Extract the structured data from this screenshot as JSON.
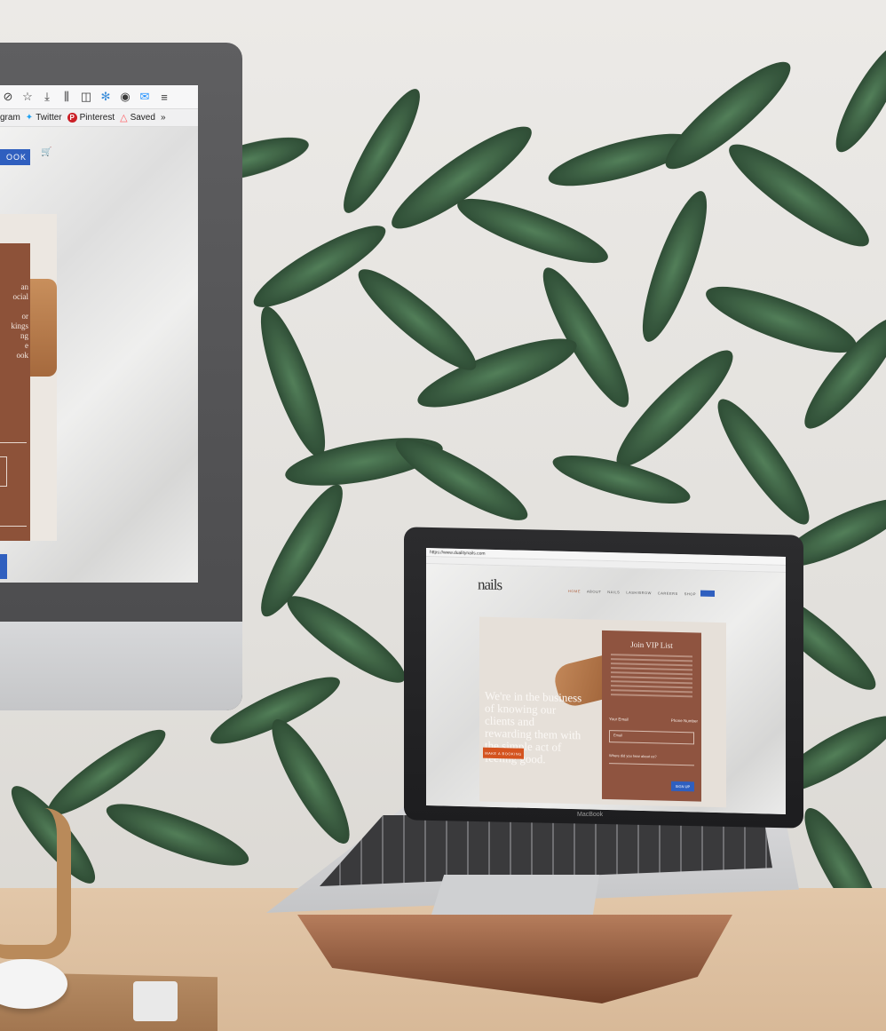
{
  "monitor": {
    "bookmarks": [
      {
        "label": "gram",
        "icon": "instagram-icon"
      },
      {
        "label": "Twitter",
        "icon": "twitter-icon"
      },
      {
        "label": "Pinterest",
        "icon": "pinterest-icon"
      },
      {
        "label": "Saved",
        "icon": "airbnb-icon"
      }
    ],
    "book_button": "OOK",
    "form_text_lines": [
      "an",
      "ocial",
      "",
      "or",
      "kings",
      "ng",
      "e",
      "ook"
    ]
  },
  "laptop": {
    "url": "https://www.dualitynails.com",
    "logo": "nails",
    "nav": [
      "HOME",
      "ABOUT",
      "NAILS",
      "LASH/BROW",
      "CAREERS",
      "SHOP"
    ],
    "headline": "We're in the business of knowing our clients and rewarding them with the simple act of feeling good.",
    "cta": "MAKE A BOOKING",
    "form": {
      "title": "Join VIP List",
      "label_email": "Your Email",
      "label_phone": "Phone Number",
      "field_placeholder": "Email",
      "question": "Where did you hear about us?",
      "submit": "SIGN UP"
    },
    "brand_label": "MacBook"
  },
  "colors": {
    "form_brown": "#8d5239",
    "cta_orange": "#d4531f",
    "book_blue": "#2f5fbf",
    "leaf_dark": "#1f3a26",
    "leaf_mid": "#2f5a38"
  }
}
